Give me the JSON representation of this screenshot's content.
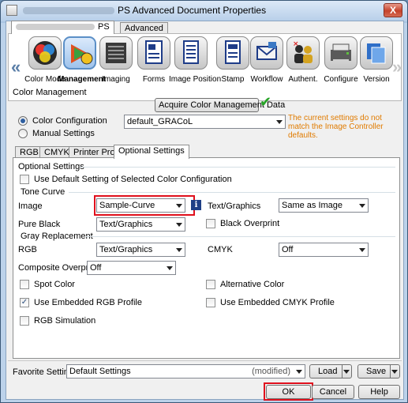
{
  "window": {
    "title": "PS Advanced Document Properties",
    "close": "X"
  },
  "top_tabs": {
    "ps": "PS",
    "advanced": "Advanced"
  },
  "functions": [
    {
      "label": "Color Mode",
      "icon": "color-mode-icon"
    },
    {
      "label": "Management",
      "icon": "color-management-icon"
    },
    {
      "label": "Imaging",
      "icon": "imaging-icon"
    },
    {
      "label": "Forms",
      "icon": "forms-icon"
    },
    {
      "label": "Image Position",
      "icon": "image-position-icon"
    },
    {
      "label": "Stamp",
      "icon": "stamp-icon"
    },
    {
      "label": "Workflow",
      "icon": "workflow-icon"
    },
    {
      "label": "Authent.",
      "icon": "authentication-icon"
    },
    {
      "label": "Configure",
      "icon": "configure-icon"
    },
    {
      "label": "Version",
      "icon": "version-icon"
    }
  ],
  "nav": {
    "left": "«",
    "right": "»"
  },
  "color_management": {
    "section_label": "Color Management",
    "acquire_button": "Acquire Color Management Data",
    "radio_color_config": "Color Configuration",
    "radio_manual": "Manual Settings",
    "color_config_value": "default_GRACoL",
    "warning": "The current settings do not match the Image Controller defaults."
  },
  "sub_tabs": [
    "RGB",
    "CMYK",
    "Printer Profile",
    "Optional Settings"
  ],
  "optional": {
    "group_label": "Optional Settings",
    "use_default_label": "Use Default Setting of Selected Color Configuration",
    "tone_curve_label": "Tone Curve",
    "image_label": "Image",
    "image_value": "Sample-Curve",
    "info_glyph": "i",
    "text_graphics_label": "Text/Graphics",
    "text_graphics_value": "Same as Image",
    "pure_black_label": "Pure Black",
    "pure_black_value": "Text/Graphics",
    "black_overprint_label": "Black Overprint",
    "gray_replacement_label": "Gray Replacement",
    "rgb_label": "RGB",
    "rgb_value": "Text/Graphics",
    "cmyk_label": "CMYK",
    "cmyk_value": "Off",
    "composite_label": "Composite Overprint",
    "composite_value": "Off",
    "spot_color_label": "Spot Color",
    "alternative_color_label": "Alternative Color",
    "embedded_rgb_label": "Use Embedded RGB Profile",
    "embedded_cmyk_label": "Use Embedded CMYK Profile",
    "rgb_simulation_label": "RGB Simulation",
    "check_glyph": "✓"
  },
  "footer": {
    "favorite_label": "Favorite Setting",
    "favorite_value": "Default Settings",
    "favorite_modified": "(modified)",
    "load_button": "Load",
    "save_button": "Save",
    "ok_button": "OK",
    "cancel_button": "Cancel",
    "help_button": "Help"
  }
}
